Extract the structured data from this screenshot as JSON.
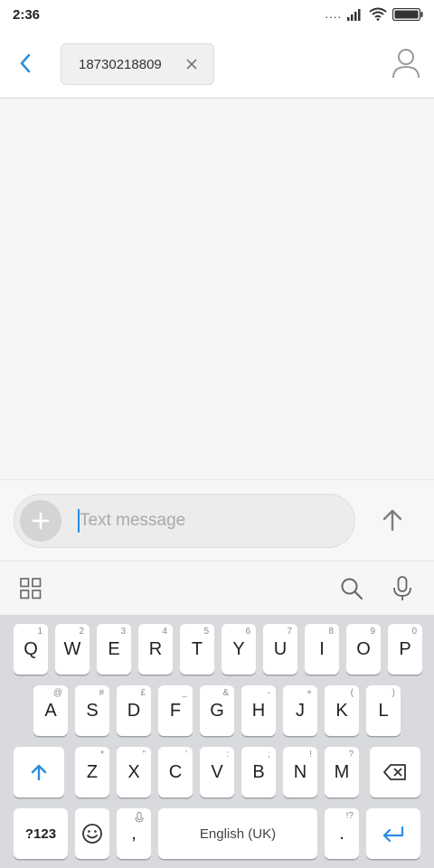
{
  "status_bar": {
    "time": "2:36",
    "dots": "...."
  },
  "header": {
    "recipient": "18730218809"
  },
  "compose": {
    "placeholder": "Text message"
  },
  "keyboard": {
    "row1": [
      {
        "label": "Q",
        "hint": "1"
      },
      {
        "label": "W",
        "hint": "2"
      },
      {
        "label": "E",
        "hint": "3"
      },
      {
        "label": "R",
        "hint": "4"
      },
      {
        "label": "T",
        "hint": "5"
      },
      {
        "label": "Y",
        "hint": "6"
      },
      {
        "label": "U",
        "hint": "7"
      },
      {
        "label": "I",
        "hint": "8"
      },
      {
        "label": "O",
        "hint": "9"
      },
      {
        "label": "P",
        "hint": "0"
      }
    ],
    "row2": [
      {
        "label": "A",
        "hint": "@"
      },
      {
        "label": "S",
        "hint": "#"
      },
      {
        "label": "D",
        "hint": "£"
      },
      {
        "label": "F",
        "hint": "_"
      },
      {
        "label": "G",
        "hint": "&"
      },
      {
        "label": "H",
        "hint": "-"
      },
      {
        "label": "J",
        "hint": "+"
      },
      {
        "label": "K",
        "hint": "("
      },
      {
        "label": "L",
        "hint": ")"
      }
    ],
    "row3": [
      {
        "label": "Z",
        "hint": "*"
      },
      {
        "label": "X",
        "hint": "\""
      },
      {
        "label": "C",
        "hint": "'"
      },
      {
        "label": "V",
        "hint": ":"
      },
      {
        "label": "B",
        "hint": ";"
      },
      {
        "label": "N",
        "hint": "!"
      },
      {
        "label": "M",
        "hint": "?"
      }
    ],
    "symbols_label": "?123",
    "comma_label": ",",
    "space_label": "English (UK)",
    "period_label": ".",
    "period_hint": "!?"
  }
}
